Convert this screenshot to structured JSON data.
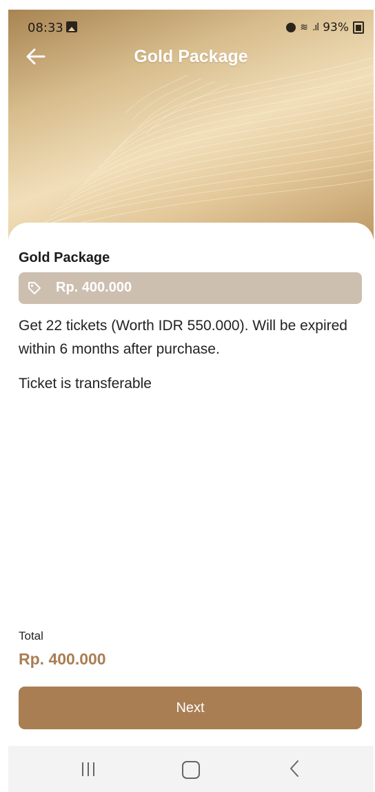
{
  "status_bar": {
    "time": "08:33",
    "battery": "93%",
    "icons": [
      "gallery-icon",
      "alarm-icon",
      "wifi-icon",
      "signal-icon",
      "battery-icon"
    ]
  },
  "header": {
    "title": "Gold Package",
    "back_icon": "arrow-left-icon"
  },
  "package": {
    "name": "Gold Package",
    "price": "Rp. 400.000",
    "price_icon": "price-tag-icon",
    "description": "Get 22 tickets (Worth IDR 550.000). Will be expired within 6 months after purchase.",
    "transfer_note": "Ticket is transferable"
  },
  "summary": {
    "total_label": "Total",
    "total_value": "Rp. 400.000"
  },
  "actions": {
    "next_label": "Next"
  },
  "nav": {
    "icons": [
      "recents-icon",
      "home-icon",
      "back-icon"
    ]
  },
  "colors": {
    "accent": "#a97e53",
    "price_tag_bg": "#cdbfb0",
    "header_gold": "#d8bd8d"
  }
}
